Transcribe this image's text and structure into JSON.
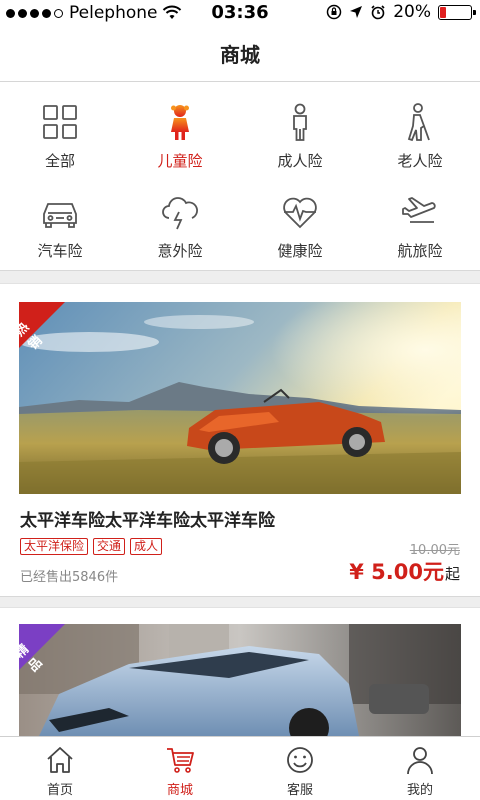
{
  "status_bar": {
    "carrier": "Pelephone",
    "time": "03:36",
    "battery_percent": "20%",
    "battery_level": 0.2,
    "icons": [
      "signal-dots",
      "wifi-icon",
      "rotation-lock-icon",
      "location-icon",
      "alarm-icon",
      "battery-icon"
    ]
  },
  "nav": {
    "title": "商城"
  },
  "categories": [
    {
      "label": "全部",
      "icon": "grid-icon",
      "active": false
    },
    {
      "label": "儿童险",
      "icon": "child-icon",
      "active": true
    },
    {
      "label": "成人险",
      "icon": "adult-icon",
      "active": false
    },
    {
      "label": "老人险",
      "icon": "elderly-icon",
      "active": false
    },
    {
      "label": "汽车险",
      "icon": "car-icon",
      "active": false
    },
    {
      "label": "意外险",
      "icon": "storm-cloud-icon",
      "active": false
    },
    {
      "label": "健康险",
      "icon": "heart-pulse-icon",
      "active": false
    },
    {
      "label": "航旅险",
      "icon": "airplane-icon",
      "active": false
    }
  ],
  "products": [
    {
      "badge": "热销",
      "badge_color": "#d0201a",
      "title": "太平洋车险太平洋车险太平洋车险",
      "tags": [
        "太平洋保险",
        "交通",
        "成人"
      ],
      "sold": "已经售出5846件",
      "original_price": "10.00元",
      "price": "¥ 5.00元",
      "price_suffix": "起",
      "image": "orange-convertible-car-photo"
    },
    {
      "badge": "精品",
      "badge_color": "#7b3fc4",
      "image": "blue-sports-car-photo"
    }
  ],
  "tab_bar": [
    {
      "label": "首页",
      "icon": "home-icon",
      "active": false
    },
    {
      "label": "商城",
      "icon": "cart-icon",
      "active": true
    },
    {
      "label": "客服",
      "icon": "smile-icon",
      "active": false
    },
    {
      "label": "我的",
      "icon": "person-icon",
      "active": false
    }
  ],
  "colors": {
    "accent": "#d0201a",
    "badge_purple": "#7b3fc4",
    "text": "#222222",
    "muted": "#888888"
  }
}
